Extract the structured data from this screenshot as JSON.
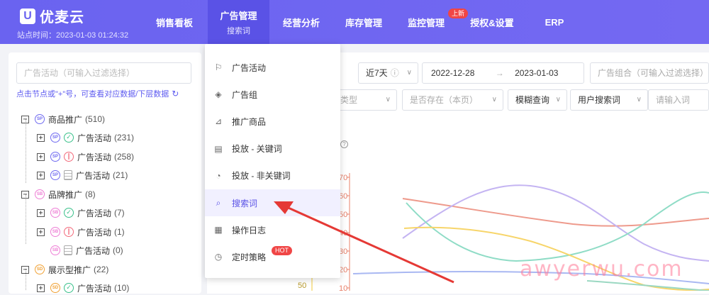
{
  "brand": {
    "logo": "U",
    "name": "优麦云",
    "site_time": "站点时间：2023-01-03 01:24:32"
  },
  "nav": {
    "items": [
      {
        "label": "销售看板"
      },
      {
        "label": "广告管理",
        "sub": "搜索词"
      },
      {
        "label": "经营分析"
      },
      {
        "label": "库存管理"
      },
      {
        "label": "监控管理",
        "badge": "上新"
      },
      {
        "label": "授权&设置"
      },
      {
        "label": "ERP"
      }
    ]
  },
  "left": {
    "filter_placeholder": "广告活动（可输入过滤选择）",
    "hint": "点击节点或\"+\"号，可查看对应数据/下层数据",
    "tree": [
      {
        "expander": "−",
        "badge": "SP",
        "label": "商品推广",
        "count": "(510)"
      },
      {
        "expander": "+",
        "badge": "SP",
        "status": "ok",
        "label": "广告活动",
        "count": "(231)"
      },
      {
        "expander": "+",
        "badge": "SP",
        "status": "pause",
        "label": "广告活动",
        "count": "(258)"
      },
      {
        "expander": "+",
        "badge": "SP",
        "status": "doc",
        "label": "广告活动",
        "count": "(21)"
      },
      {
        "expander": "−",
        "badge": "SB",
        "label": "品牌推广",
        "count": "(8)"
      },
      {
        "expander": "+",
        "badge": "SB",
        "status": "ok",
        "label": "广告活动",
        "count": "(7)"
      },
      {
        "expander": "+",
        "badge": "SB",
        "status": "pause",
        "label": "广告活动",
        "count": "(1)"
      },
      {
        "expander": "",
        "badge": "SB",
        "status": "doc",
        "label": "广告活动",
        "count": "(0)"
      },
      {
        "expander": "−",
        "badge": "SD",
        "label": "展示型推广",
        "count": "(22)"
      },
      {
        "expander": "+",
        "badge": "SD",
        "status": "ok",
        "label": "广告活动",
        "count": "(10)"
      }
    ]
  },
  "controls": {
    "date_range": "近7天",
    "date_start": "2022-12-28",
    "date_end": "2023-01-03",
    "ad_group_placeholder": "广告组合（可输入过滤选择）",
    "match_type_placeholder": "类型",
    "exists_placeholder": "是否存在（本页）",
    "query_mode": "模糊查询",
    "query_field": "用户搜索词",
    "query_placeholder": "请输入词"
  },
  "dropdown": {
    "items": [
      {
        "icon": "flag-icon",
        "glyph": "⚐",
        "label": "广告活动"
      },
      {
        "icon": "layers-icon",
        "glyph": "◈",
        "label": "广告组"
      },
      {
        "icon": "product-icon",
        "glyph": "⊿",
        "label": "推广商品"
      },
      {
        "icon": "keyword-icon",
        "glyph": "▤",
        "label": "投放 - 关键词"
      },
      {
        "icon": "target-icon",
        "glyph": "◔",
        "label": "投放 - 非关键词"
      },
      {
        "icon": "search-icon",
        "glyph": "⌕",
        "label": "搜索词",
        "active": true
      },
      {
        "icon": "log-icon",
        "glyph": "▦",
        "label": "操作日志"
      },
      {
        "icon": "timer-icon",
        "glyph": "◷",
        "label": "定时策略",
        "badge": "HOT"
      }
    ]
  },
  "chart_axis": {
    "right_ticks": [
      "70",
      "60",
      "50",
      "40",
      "30",
      "20",
      "10"
    ],
    "left_tick": "50"
  },
  "watermark": "awyerwu.com",
  "colors": {
    "brand": "#6a63f0",
    "accent": "#5a52e6",
    "hot": "#f04646"
  }
}
